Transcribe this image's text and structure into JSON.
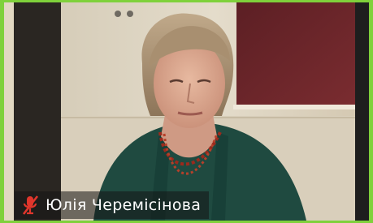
{
  "participant": {
    "name": "Юлія Черемісінова",
    "muted": true,
    "active_speaker": true
  },
  "icons": {
    "mic_state": "mic-muted-icon"
  },
  "colors": {
    "active_speaker_border": "#7fd13b",
    "muted_icon": "#e0362c",
    "name_text": "#ffffff"
  }
}
